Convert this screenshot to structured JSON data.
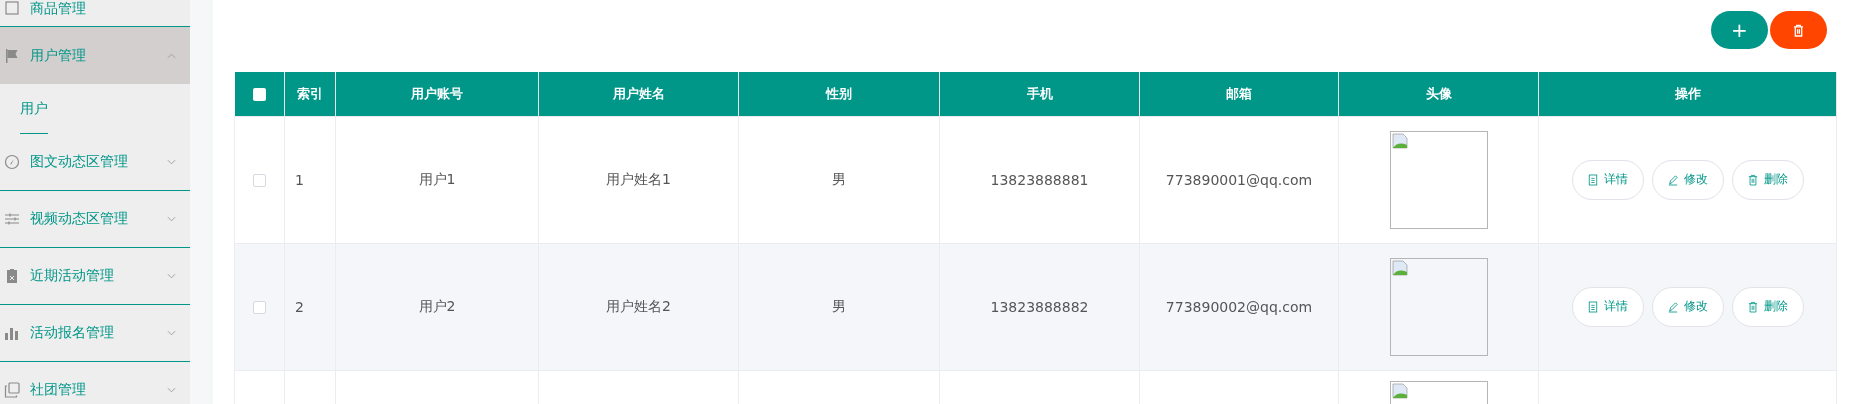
{
  "sidebar": {
    "items": [
      {
        "label": "商品管理",
        "expanded": false
      },
      {
        "label": "用户管理",
        "expanded": true,
        "children": [
          {
            "label": "用户"
          }
        ]
      },
      {
        "label": "图文动态区管理",
        "expanded": false
      },
      {
        "label": "视频动态区管理",
        "expanded": false
      },
      {
        "label": "近期活动管理",
        "expanded": false
      },
      {
        "label": "活动报名管理",
        "expanded": false
      },
      {
        "label": "社团管理",
        "expanded": false
      }
    ]
  },
  "toolbar": {
    "add_button": "+"
  },
  "table": {
    "all_checked": false,
    "columns": [
      "索引",
      "用户账号",
      "用户姓名",
      "性别",
      "手机",
      "邮箱",
      "头像",
      "操作"
    ],
    "rows": [
      {
        "kind": "full",
        "checked": false,
        "index": "1",
        "account": "用户1",
        "name": "用户姓名1",
        "gender": "男",
        "phone": "13823888881",
        "email": "773890001@qq.com",
        "actions": [
          "详情",
          "修改",
          "删除"
        ]
      },
      {
        "kind": "full",
        "checked": false,
        "index": "2",
        "account": "用户2",
        "name": "用户姓名2",
        "gender": "男",
        "phone": "13823888882",
        "email": "773890002@qq.com",
        "actions": [
          "详情",
          "修改",
          "删除"
        ]
      },
      {
        "kind": "partial"
      }
    ]
  }
}
